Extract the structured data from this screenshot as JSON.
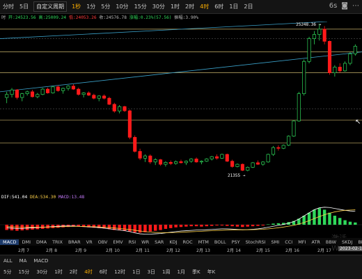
{
  "toolbar": {
    "items": [
      {
        "label": "分时"
      },
      {
        "label": "5日"
      },
      {
        "label": "1分"
      },
      {
        "label": "5分"
      },
      {
        "label": "10分"
      },
      {
        "label": "15分"
      },
      {
        "label": "30分"
      },
      {
        "label": "1时"
      },
      {
        "label": "2时"
      },
      {
        "label": "4时"
      },
      {
        "label": "6时"
      },
      {
        "label": "1日"
      },
      {
        "label": "2日"
      }
    ],
    "period_select": "自定义周期",
    "period_value": "1秒",
    "right_period": "6s",
    "active_index": 9
  },
  "ohlc": {
    "prefix": "时",
    "open": "开:24523.56",
    "high": "高:25009.24",
    "low": "低:24053.26",
    "close": "收:24576.78",
    "change": "涨幅:0.23%(57.56)",
    "amplitude": "振幅:3.90%"
  },
  "annotations": {
    "high_label": "25248.36",
    "low_label": "21355"
  },
  "macd_readout": {
    "dif": "DIF:541.04",
    "dea": "DEA:534.30",
    "macd": "MACD:13.48"
  },
  "indicators": [
    "MACD",
    "DMI",
    "DMA",
    "TRIX",
    "BRAR",
    "VR",
    "OBV",
    "EMV",
    "RSI",
    "WR",
    "SAR",
    "KDJ",
    "ROC",
    "MTM",
    "BOLL",
    "PSY",
    "StochRSI",
    "SMI",
    "CCI",
    "MFI",
    "ATR",
    "BBW",
    "SKDJ",
    "BIAS",
    "DPO",
    "AO",
    "Position"
  ],
  "dates": [
    "2月 7",
    "2月 8",
    "2月 9",
    "2月 10",
    "2月 11",
    "2月 12",
    "2月 13",
    "2月 14",
    "2月 15",
    "2月 16",
    "2月 17"
  ],
  "current_date": "2023-02-1",
  "bottom_row1": [
    "ALL",
    "MA",
    "MACD"
  ],
  "bottom_row2": [
    "5分",
    "15分",
    "30分",
    "1时",
    "2时",
    "4时",
    "6时",
    "12时",
    "1日",
    "3日",
    "1周",
    "1月",
    "季K",
    "年K"
  ],
  "bottom_active": "4时",
  "watermark": "激活 Win",
  "colors": {
    "up": "#2fd85a",
    "down": "#ff1a1a",
    "accent": "#ffb000",
    "trend": "#3aa0c8",
    "level": "#c8b26a"
  },
  "chart_data": {
    "type": "candlestick",
    "note_scale": [
      20900,
      25300
    ],
    "candles": [
      [
        23300,
        23450,
        23150,
        23380
      ],
      [
        23380,
        23550,
        23300,
        23500
      ],
      [
        23500,
        23520,
        23250,
        23300
      ],
      [
        23300,
        23420,
        23200,
        23400
      ],
      [
        23400,
        23480,
        23350,
        23450
      ],
      [
        23450,
        23500,
        23300,
        23320
      ],
      [
        23320,
        23420,
        23280,
        23380
      ],
      [
        23380,
        23550,
        23360,
        23520
      ],
      [
        23520,
        23560,
        23400,
        23420
      ],
      [
        23420,
        23600,
        23400,
        23580
      ],
      [
        23580,
        23620,
        23450,
        23480
      ],
      [
        23480,
        23560,
        23400,
        23540
      ],
      [
        23540,
        23620,
        23480,
        23600
      ],
      [
        23600,
        23650,
        23500,
        23520
      ],
      [
        23520,
        23560,
        23350,
        23380
      ],
      [
        23380,
        23440,
        23300,
        23420
      ],
      [
        23420,
        23460,
        23340,
        23360
      ],
      [
        23360,
        23400,
        23250,
        23280
      ],
      [
        23280,
        23360,
        23200,
        23340
      ],
      [
        23340,
        23380,
        23250,
        23280
      ],
      [
        23280,
        23320,
        23100,
        23120
      ],
      [
        23120,
        23160,
        22900,
        22940
      ],
      [
        22940,
        23100,
        22880,
        23060
      ],
      [
        23060,
        23080,
        22920,
        22950
      ],
      [
        22950,
        22980,
        22200,
        22250
      ],
      [
        22250,
        22300,
        21850,
        21880
      ],
      [
        21880,
        21950,
        21650,
        21700
      ],
      [
        21700,
        21800,
        21600,
        21760
      ],
      [
        21760,
        21800,
        21550,
        21600
      ],
      [
        21600,
        21700,
        21520,
        21660
      ],
      [
        21660,
        21680,
        21500,
        21540
      ],
      [
        21540,
        21620,
        21480,
        21590
      ],
      [
        21590,
        21640,
        21520,
        21560
      ],
      [
        21560,
        21640,
        21530,
        21610
      ],
      [
        21610,
        21660,
        21560,
        21580
      ],
      [
        21580,
        21640,
        21520,
        21620
      ],
      [
        21620,
        21700,
        21580,
        21680
      ],
      [
        21680,
        21720,
        21580,
        21600
      ],
      [
        21600,
        21640,
        21540,
        21620
      ],
      [
        21620,
        21700,
        21600,
        21680
      ],
      [
        21680,
        21760,
        21640,
        21740
      ],
      [
        21740,
        21800,
        21660,
        21700
      ],
      [
        21700,
        21820,
        21680,
        21800
      ],
      [
        21800,
        21820,
        21600,
        21620
      ],
      [
        21620,
        21660,
        21450,
        21480
      ],
      [
        21480,
        21560,
        21460,
        21540
      ],
      [
        21540,
        21560,
        21360,
        21380
      ],
      [
        21380,
        21480,
        21355,
        21460
      ],
      [
        21460,
        21600,
        21440,
        21580
      ],
      [
        21580,
        21640,
        21520,
        21540
      ],
      [
        21540,
        21620,
        21500,
        21600
      ],
      [
        21600,
        21820,
        21580,
        21800
      ],
      [
        21800,
        22020,
        21760,
        21980
      ],
      [
        21980,
        22040,
        21900,
        21960
      ],
      [
        21960,
        22060,
        21940,
        22040
      ],
      [
        22040,
        22300,
        22020,
        22280
      ],
      [
        22280,
        22700,
        22260,
        22680
      ],
      [
        22680,
        23450,
        22660,
        23400
      ],
      [
        23400,
        24300,
        23350,
        24250
      ],
      [
        24250,
        24900,
        24200,
        24850
      ],
      [
        24850,
        25050,
        24700,
        24960
      ],
      [
        24960,
        25248,
        24800,
        25100
      ],
      [
        25100,
        25180,
        24700,
        24780
      ],
      [
        24780,
        24800,
        23900,
        23950
      ],
      [
        23950,
        24150,
        23850,
        24100
      ],
      [
        24100,
        24200,
        23950,
        24000
      ],
      [
        24000,
        24250,
        23980,
        24200
      ],
      [
        24200,
        24500,
        24150,
        24450
      ],
      [
        24450,
        24700,
        24400,
        24650
      ]
    ],
    "macd_hist": [
      -0.7,
      -0.75,
      -0.8,
      -0.75,
      -0.7,
      -0.65,
      -0.6,
      -0.55,
      -0.5,
      -0.45,
      -0.4,
      -0.35,
      -0.3,
      -0.25,
      -0.25,
      -0.3,
      -0.35,
      -0.4,
      -0.45,
      -0.5,
      -0.6,
      -0.7,
      -0.75,
      -0.8,
      -0.9,
      -1.0,
      -1.05,
      -1.0,
      -0.9,
      -0.8,
      -0.7,
      -0.55,
      -0.45,
      -0.35,
      -0.3,
      -0.25,
      -0.2,
      -0.2,
      -0.25,
      -0.2,
      -0.15,
      -0.1,
      -0.1,
      -0.15,
      -0.2,
      -0.25,
      -0.3,
      -0.25,
      -0.2,
      -0.15,
      -0.1,
      0.05,
      0.15,
      0.2,
      0.25,
      0.35,
      0.5,
      0.8,
      1.2,
      1.6,
      2.0,
      2.2,
      2.0,
      1.6,
      1.2,
      0.9,
      0.6,
      0.4,
      0.3
    ],
    "dif": [
      -0.5,
      -0.55,
      -0.6,
      -0.6,
      -0.55,
      -0.5,
      -0.45,
      -0.4,
      -0.35,
      -0.3,
      -0.25,
      -0.2,
      -0.2,
      -0.2,
      -0.25,
      -0.3,
      -0.35,
      -0.4,
      -0.45,
      -0.55,
      -0.65,
      -0.75,
      -0.85,
      -0.95,
      -1.1,
      -1.3,
      -1.45,
      -1.5,
      -1.5,
      -1.45,
      -1.4,
      -1.3,
      -1.2,
      -1.1,
      -1.0,
      -0.95,
      -0.9,
      -0.85,
      -0.85,
      -0.8,
      -0.75,
      -0.7,
      -0.65,
      -0.65,
      -0.7,
      -0.75,
      -0.8,
      -0.78,
      -0.72,
      -0.65,
      -0.55,
      -0.4,
      -0.25,
      -0.1,
      0.05,
      0.25,
      0.5,
      0.9,
      1.4,
      1.9,
      2.4,
      2.7,
      2.8,
      2.75,
      2.6,
      2.45,
      2.3,
      2.2,
      2.15
    ],
    "dea": [
      -0.3,
      -0.33,
      -0.36,
      -0.39,
      -0.4,
      -0.4,
      -0.4,
      -0.39,
      -0.37,
      -0.35,
      -0.33,
      -0.3,
      -0.28,
      -0.26,
      -0.26,
      -0.27,
      -0.29,
      -0.32,
      -0.35,
      -0.4,
      -0.45,
      -0.52,
      -0.6,
      -0.68,
      -0.77,
      -0.88,
      -1.0,
      -1.1,
      -1.18,
      -1.23,
      -1.26,
      -1.27,
      -1.26,
      -1.24,
      -1.2,
      -1.16,
      -1.12,
      -1.08,
      -1.04,
      -1.0,
      -0.96,
      -0.92,
      -0.88,
      -0.84,
      -0.82,
      -0.81,
      -0.81,
      -0.8,
      -0.79,
      -0.76,
      -0.72,
      -0.66,
      -0.58,
      -0.48,
      -0.37,
      -0.24,
      -0.09,
      0.1,
      0.35,
      0.65,
      0.98,
      1.3,
      1.6,
      1.85,
      2.05,
      2.2,
      2.3,
      2.35,
      2.38
    ]
  }
}
